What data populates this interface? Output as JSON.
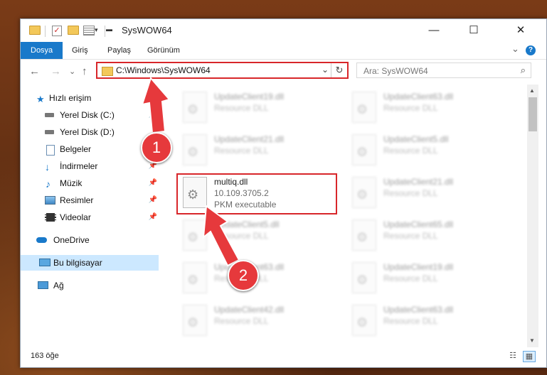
{
  "window": {
    "title": "SysWOW64",
    "minimize": "—",
    "maximize": "☐",
    "close": "✕"
  },
  "ribbon": {
    "tabs": [
      "Dosya",
      "Giriş",
      "Paylaş",
      "Görünüm"
    ],
    "active_tab": "Dosya",
    "expand": "⌄",
    "help": "?"
  },
  "nav": {
    "back": "←",
    "forward": "→",
    "recent": "⌄",
    "up": "↑"
  },
  "address": {
    "path": "C:\\Windows\\SysWOW64",
    "dropdown": "⌄",
    "refresh": "↻"
  },
  "search": {
    "placeholder": "Ara: SysWOW64",
    "icon": "⌕"
  },
  "sidebar": {
    "items": [
      {
        "label": "Hızlı erişim",
        "icon": "star-icon"
      },
      {
        "label": "Yerel Disk (C:)",
        "icon": "drive-icon"
      },
      {
        "label": "Yerel Disk (D:)",
        "icon": "drive-icon"
      },
      {
        "label": "Belgeler",
        "icon": "document-icon"
      },
      {
        "label": "İndirmeler",
        "icon": "download-icon"
      },
      {
        "label": "Müzik",
        "icon": "music-icon"
      },
      {
        "label": "Resimler",
        "icon": "pictures-icon"
      },
      {
        "label": "Videolar",
        "icon": "video-icon"
      },
      {
        "label": "OneDrive",
        "icon": "cloud-icon"
      },
      {
        "label": "Bu bilgisayar",
        "icon": "computer-icon"
      },
      {
        "label": "Ağ",
        "icon": "network-icon"
      }
    ],
    "pin": "📌"
  },
  "files": {
    "left": [
      {
        "name": "UpdateClient19.dll",
        "type": "Resource DLL"
      },
      {
        "name": "UpdateClient21.dll",
        "type": "Resource DLL"
      },
      {
        "name": "multiq.dll",
        "version": "10.109.3705.2",
        "type": "PKM executable"
      },
      {
        "name": "UpdateClient5.dll",
        "type": "Resource DLL"
      },
      {
        "name": "UpdateClient63.dll",
        "type": "Resource DLL"
      },
      {
        "name": "UpdateClient42.dll",
        "type": "Resource DLL"
      }
    ],
    "right": [
      {
        "name": "UpdateClient63.dll",
        "type": "Resource DLL"
      },
      {
        "name": "UpdateClient5.dll",
        "type": "Resource DLL"
      },
      {
        "name": "UpdateClient21.dll",
        "type": "Resource DLL"
      },
      {
        "name": "UpdateClient65.dll",
        "type": "Resource DLL"
      },
      {
        "name": "UpdateClient19.dll",
        "type": "Resource DLL"
      },
      {
        "name": "UpdateClient63.dll",
        "type": "Resource DLL"
      }
    ]
  },
  "status": {
    "count": "163 öğe"
  },
  "annotations": {
    "badge1": "1",
    "badge2": "2"
  },
  "colors": {
    "accent": "#1979ca",
    "highlight": "#d8262a",
    "badge": "#e6393c"
  }
}
